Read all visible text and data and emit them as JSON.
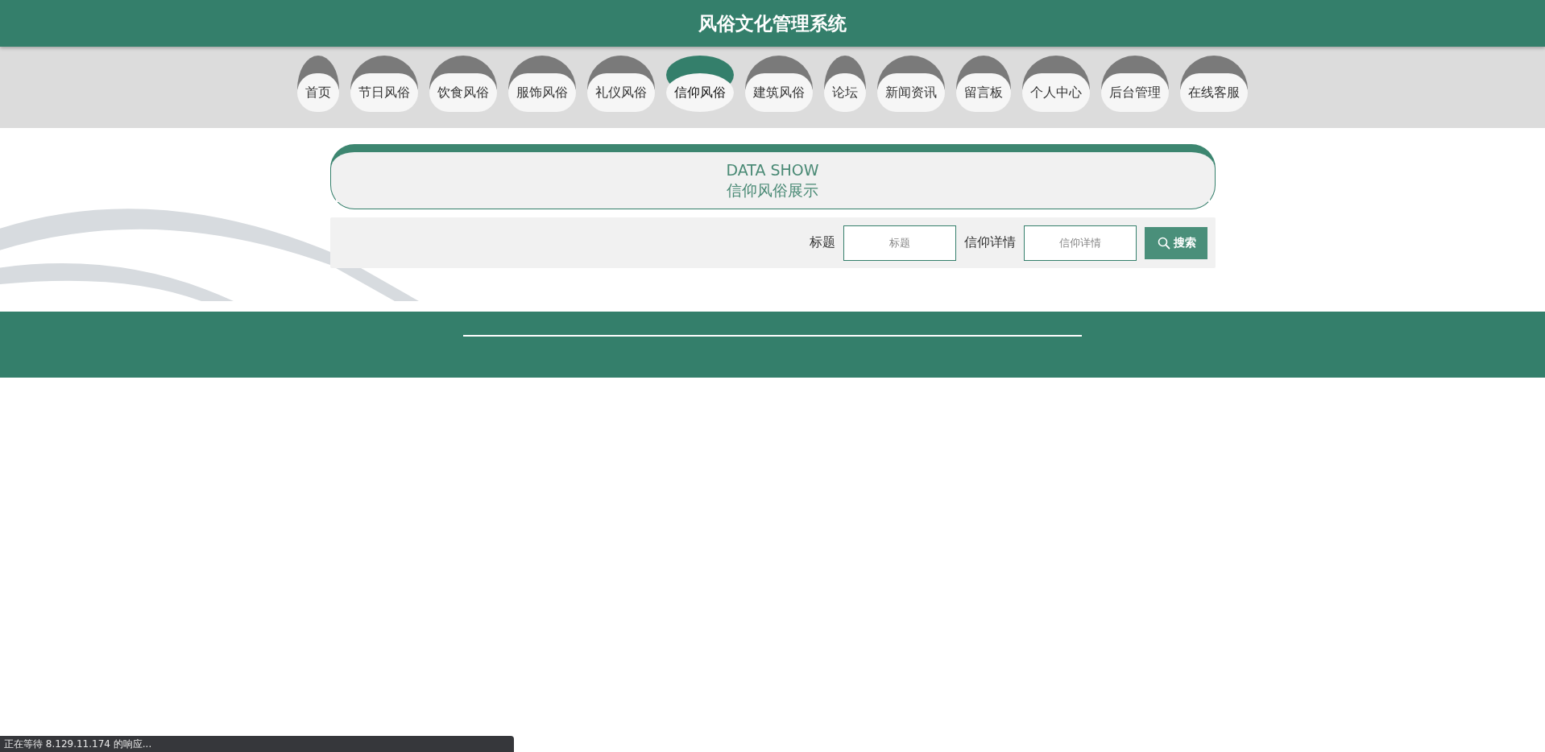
{
  "header": {
    "title": "风俗文化管理系统"
  },
  "nav": [
    {
      "label": "首页",
      "selected": false
    },
    {
      "label": "节日风俗",
      "selected": false
    },
    {
      "label": "饮食风俗",
      "selected": false
    },
    {
      "label": "服饰风俗",
      "selected": false
    },
    {
      "label": "礼仪风俗",
      "selected": false
    },
    {
      "label": "信仰风俗",
      "selected": true
    },
    {
      "label": "建筑风俗",
      "selected": false
    },
    {
      "label": "论坛",
      "selected": false
    },
    {
      "label": "新闻资讯",
      "selected": false
    },
    {
      "label": "留言板",
      "selected": false
    },
    {
      "label": "个人中心",
      "selected": false
    },
    {
      "label": "后台管理",
      "selected": false
    },
    {
      "label": "在线客服",
      "selected": false
    }
  ],
  "banner": {
    "title": "DATA SHOW",
    "subtitle": "信仰风俗展示"
  },
  "search": {
    "fields": [
      {
        "label": "标题",
        "placeholder": "标题"
      },
      {
        "label": "信仰详情",
        "placeholder": "信仰详情"
      }
    ],
    "button": "搜索"
  },
  "status_bar": {
    "text": "正在等待 8.129.11.174 的响应..."
  }
}
